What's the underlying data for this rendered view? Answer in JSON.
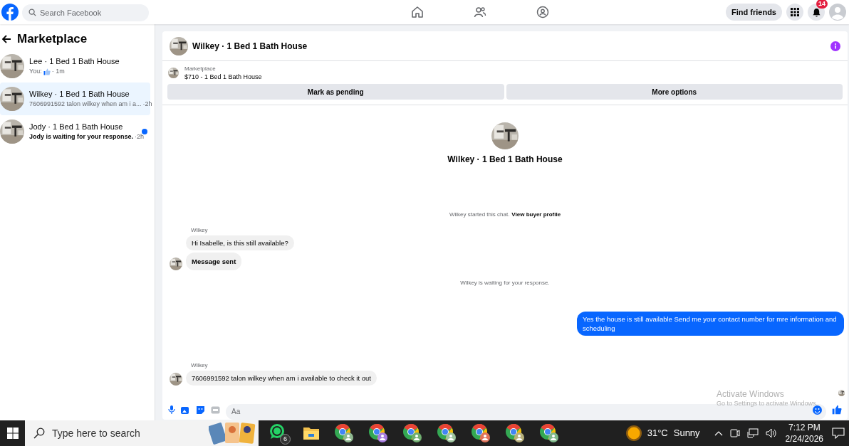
{
  "topbar": {
    "search_placeholder": "Search Facebook",
    "find_friends": "Find friends",
    "notification_count": "14"
  },
  "sidebar": {
    "title": "Marketplace",
    "conversations": [
      {
        "title": "Lee · 1 Bed 1 Bath House",
        "kind": "like",
        "preview": "You:",
        "time": "· 1m",
        "selected": false,
        "unread": false
      },
      {
        "title": "Wilkey · 1 Bed 1 Bath House",
        "kind": "text",
        "preview": "7606991592 talon wilkey when am i a...",
        "time": "·2h",
        "selected": true,
        "unread": false
      },
      {
        "title": "Jody · 1 Bed 1 Bath House",
        "kind": "text",
        "preview": "Jody is waiting for your response.",
        "time": "·2h",
        "selected": false,
        "unread": true
      }
    ]
  },
  "chat": {
    "title": "Wilkey · 1 Bed 1 Bath House",
    "listing": {
      "label": "Marketplace",
      "item": "$710 - 1 Bed 1 Bath House"
    },
    "buttons": [
      "Mark as pending",
      "More options"
    ],
    "profile_name": "Wilkey · 1 Bed 1 Bath House",
    "messages": [
      {
        "kind": "system",
        "text": "Wilkey started this chat.",
        "link": "View buyer profile"
      },
      {
        "kind": "incoming",
        "sender": "Wilkey",
        "bubbles": [
          {
            "text": "Hi Isabelle, is this still available?",
            "emphasis": false
          },
          {
            "text": "Message sent",
            "emphasis": true
          }
        ]
      },
      {
        "kind": "system",
        "text": "Wilkey is waiting for your response."
      },
      {
        "kind": "outgoing",
        "bubbles": [
          {
            "text": "Yes the house is still available  Send me your contact number for mre information and  scheduling",
            "emphasis": false
          }
        ]
      },
      {
        "kind": "incoming",
        "sender": "Wilkey",
        "bubbles": [
          {
            "text": "7606991592 talon wilkey when am i available to check it out",
            "emphasis": false
          }
        ]
      }
    ],
    "composer_placeholder": "Aa"
  },
  "activation": {
    "title": "Activate Windows",
    "subtitle": "Go to Settings to activate Windows."
  },
  "taskbar": {
    "search_placeholder": "Type here to search",
    "whatsapp_badge": "6",
    "browser_profiles": [
      {
        "color": "#8fb88f"
      },
      {
        "color": "#a77be0"
      },
      {
        "color": "#6fae6f"
      },
      {
        "color": "#9ec59e"
      },
      {
        "color": "#e0735a"
      },
      {
        "color": "#b7b07a"
      },
      {
        "color": "#7fb98a"
      }
    ],
    "temperature": "31°C",
    "weather": "Sunny",
    "time": "7:12 PM",
    "date": "2/24/2026"
  }
}
